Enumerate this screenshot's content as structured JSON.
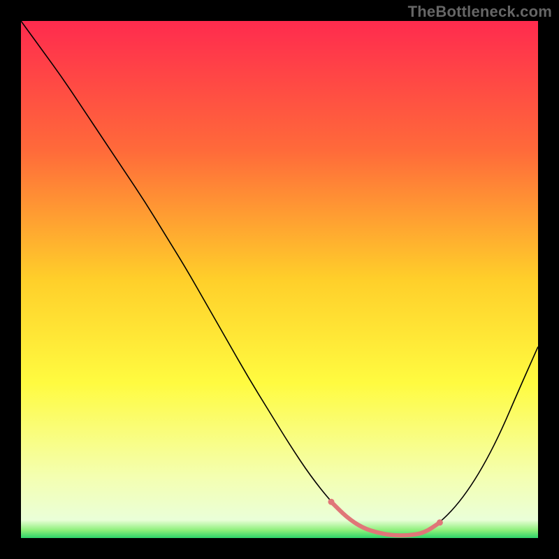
{
  "watermark": {
    "text": "TheBottleneck.com"
  },
  "chart_data": {
    "type": "line",
    "title": "",
    "xlabel": "",
    "ylabel": "",
    "xlim": [
      0,
      100
    ],
    "ylim": [
      0,
      100
    ],
    "grid": false,
    "background_gradient": {
      "stops": [
        {
          "offset": 0.0,
          "color": "#ff2b4e"
        },
        {
          "offset": 0.25,
          "color": "#ff6a3a"
        },
        {
          "offset": 0.5,
          "color": "#ffcf2a"
        },
        {
          "offset": 0.7,
          "color": "#fffb40"
        },
        {
          "offset": 0.88,
          "color": "#f4ffb0"
        },
        {
          "offset": 0.965,
          "color": "#eaffd8"
        },
        {
          "offset": 0.985,
          "color": "#8cf07a"
        },
        {
          "offset": 1.0,
          "color": "#2dd36a"
        }
      ]
    },
    "series": [
      {
        "name": "bottleneck-curve",
        "color": "#000000",
        "width": 1.6,
        "x": [
          0,
          4,
          8,
          12,
          16,
          20,
          24,
          28,
          32,
          36,
          40,
          44,
          48,
          52,
          56,
          60,
          63,
          66,
          69,
          72,
          75,
          78,
          81,
          84,
          87,
          90,
          93,
          96,
          100
        ],
        "y": [
          100,
          94.5,
          89,
          83,
          77,
          71,
          65,
          58.5,
          52,
          45,
          38,
          31,
          24.5,
          18,
          12,
          7,
          4,
          2,
          1,
          0.5,
          0.5,
          1,
          3,
          6,
          10,
          15,
          21,
          28,
          37
        ]
      }
    ],
    "highlight_band": {
      "name": "optimal-range",
      "color": "#e07678",
      "x_start": 60,
      "x_end": 81,
      "y_baseline": 0.5,
      "thickness": 6,
      "endcap_radius": 4.5
    }
  }
}
